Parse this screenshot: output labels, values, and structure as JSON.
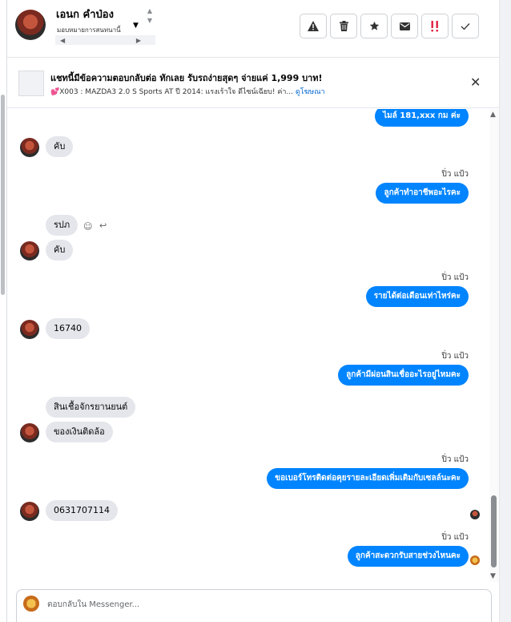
{
  "header": {
    "contact_name": "เอนก คำป่อง",
    "assign_label": "มอบหมายการสนทนานี้",
    "dropdown_icon": "caret-down-icon",
    "actions": [
      {
        "name": "spam-button",
        "icon": "warning-icon",
        "glyph": "⚠"
      },
      {
        "name": "delete-button",
        "icon": "trash-icon",
        "glyph": "🗑"
      },
      {
        "name": "star-button",
        "icon": "star-icon",
        "glyph": "★"
      },
      {
        "name": "mark-unread-button",
        "icon": "envelope-icon",
        "glyph": "✉"
      },
      {
        "name": "follow-up-button",
        "icon": "exclamation-icon",
        "glyph": "!!"
      },
      {
        "name": "done-button",
        "icon": "check-icon",
        "glyph": "✓"
      }
    ]
  },
  "ad": {
    "title": "แชทนี้มีข้อความตอบกลับต่อ ทักเลย รับรถง่ายสุดๆ จ่ายแค่ 1,999 บาท!",
    "subtitle": "💕X003 : MAZDA3 2.0 S Sports AT ปี 2014: แรงเร้าใจ ดีไซน์เฉียบ! ค่า...",
    "link": "ดูโฆษณา",
    "close_icon": "close-icon"
  },
  "thread": {
    "agent_name": "ปิ่ว แป้ว",
    "messages": [
      {
        "dir": "out",
        "text": "ไมล์ 181,xxx  กม ค่ะ"
      },
      {
        "dir": "in",
        "text": "คับ"
      },
      {
        "dir": "out",
        "sender": "ปิ่ว แป้ว",
        "text": "ลูกค้าทำอาชีพอะไรคะ"
      },
      {
        "dir": "in",
        "text": "รปภ"
      },
      {
        "dir": "in",
        "text": "คับ"
      },
      {
        "dir": "out",
        "sender": "ปิ่ว แป้ว",
        "text": "รายได้ต่อเดือนเท่าไหร่คะ"
      },
      {
        "dir": "in",
        "text": "16740"
      },
      {
        "dir": "out",
        "sender": "ปิ่ว แป้ว",
        "text": "ลูกค้ามีผ่อนสินเชื่ออะไรอยู่ไหมคะ"
      },
      {
        "dir": "in",
        "text": "สินเชื้อจักรยานยนต์"
      },
      {
        "dir": "in",
        "text": "ของเงินติดล้อ"
      },
      {
        "dir": "out",
        "sender": "ปิ่ว แป้ว",
        "text": "ขอเบอร์โทรติดต่อคุยรายละเอียดเพิ่มเติมกับเซลล์นะคะ"
      },
      {
        "dir": "in",
        "text": "0631707114"
      },
      {
        "dir": "out",
        "sender": "ปิ่ว แป้ว",
        "text": "ลูกค้าสะดวกรับสายช่วงไหนคะ"
      }
    ]
  },
  "composer": {
    "placeholder": "ตอบกลับใน Messenger..."
  }
}
